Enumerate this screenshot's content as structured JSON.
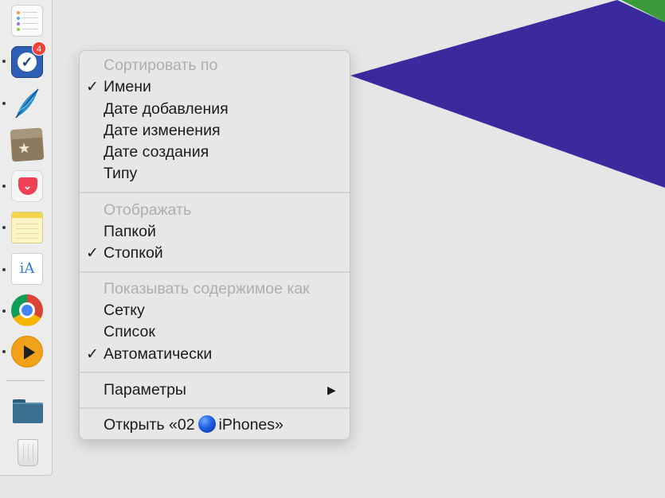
{
  "desktop": {
    "colors": {
      "background": "#e6e6e6",
      "purple": "#3b2a9d",
      "green": "#3a9a3a"
    }
  },
  "dock": {
    "apps": [
      {
        "name": "reminders",
        "icon": "reminders-icon",
        "running": false
      },
      {
        "name": "omnifocus",
        "icon": "checkmark-tray-icon",
        "running": true,
        "badge": "4"
      },
      {
        "name": "quill",
        "icon": "feather-icon",
        "running": true
      },
      {
        "name": "box",
        "icon": "star-box-icon",
        "running": false
      },
      {
        "name": "pocket",
        "icon": "pocket-icon",
        "running": true
      },
      {
        "name": "notes",
        "icon": "notes-icon",
        "running": true
      },
      {
        "name": "ia-writer",
        "icon": "ia-writer-icon",
        "running": true,
        "label": "iA"
      },
      {
        "name": "chrome",
        "icon": "chrome-icon",
        "running": true
      },
      {
        "name": "player",
        "icon": "play-icon",
        "running": true
      }
    ],
    "folder_icon": "folder-icon",
    "trash_icon": "trash-icon"
  },
  "menu": {
    "sort": {
      "header": "Сортировать по",
      "items": [
        "Имени",
        "Дате добавления",
        "Дате изменения",
        "Дате создания",
        "Типу"
      ],
      "checked": "Имени"
    },
    "display": {
      "header": "Отображать",
      "items": [
        "Папкой",
        "Стопкой"
      ],
      "checked": "Стопкой"
    },
    "view": {
      "header": "Показывать содержимое как",
      "items": [
        "Сетку",
        "Список",
        "Автоматически"
      ],
      "checked": "Автоматически"
    },
    "options": {
      "label": "Параметры",
      "submenu_arrow": "▶"
    },
    "open": {
      "prefix": "Открыть «02",
      "suffix": "iPhones»"
    },
    "check_glyph": "✓"
  }
}
